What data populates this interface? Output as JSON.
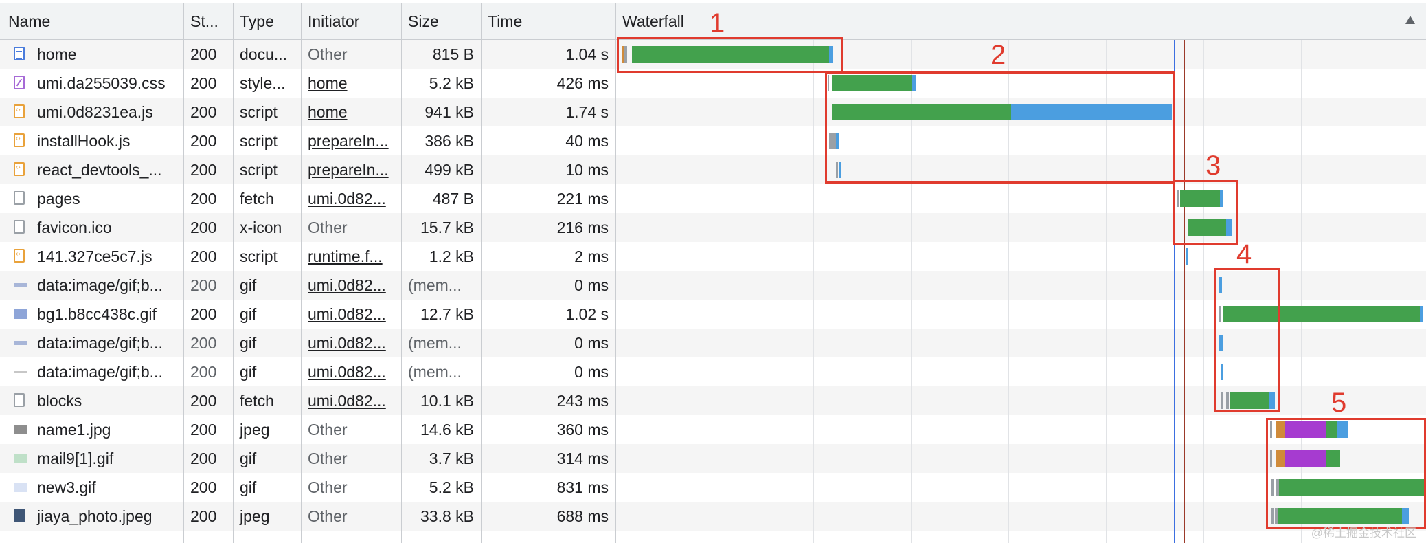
{
  "columns": {
    "name": "Name",
    "status": "St...",
    "type": "Type",
    "initiator": "Initiator",
    "size": "Size",
    "time": "Time",
    "waterfall": "Waterfall"
  },
  "rows": [
    {
      "name": "home",
      "status": "200",
      "type": "docu...",
      "initiator": "Other",
      "size": "815 B",
      "time": "1.04 s",
      "icon": "document-icon"
    },
    {
      "name": "umi.da255039.css",
      "status": "200",
      "type": "style...",
      "initiator": "home",
      "size": "5.2 kB",
      "time": "426 ms",
      "icon": "stylesheet-icon"
    },
    {
      "name": "umi.0d8231ea.js",
      "status": "200",
      "type": "script",
      "initiator": "home",
      "size": "941 kB",
      "time": "1.74 s",
      "icon": "script-icon"
    },
    {
      "name": "installHook.js",
      "status": "200",
      "type": "script",
      "initiator": "prepareIn...",
      "size": "386 kB",
      "time": "40 ms",
      "icon": "script-icon"
    },
    {
      "name": "react_devtools_...",
      "status": "200",
      "type": "script",
      "initiator": "prepareIn...",
      "size": "499 kB",
      "time": "10 ms",
      "icon": "script-icon"
    },
    {
      "name": "pages",
      "status": "200",
      "type": "fetch",
      "initiator": "umi.0d82...",
      "size": "487 B",
      "time": "221 ms",
      "icon": "fetch-icon"
    },
    {
      "name": "favicon.ico",
      "status": "200",
      "type": "x-icon",
      "initiator": "Other",
      "size": "15.7 kB",
      "time": "216 ms",
      "icon": "blank-file-icon"
    },
    {
      "name": "141.327ce5c7.js",
      "status": "200",
      "type": "script",
      "initiator": "runtime.f...",
      "size": "1.2 kB",
      "time": "2 ms",
      "icon": "script-icon"
    },
    {
      "name": "data:image/gif;b...",
      "status": "200",
      "type": "gif",
      "initiator": "umi.0d82...",
      "size": "(mem...",
      "time": "0 ms",
      "icon": "image-icon"
    },
    {
      "name": "bg1.b8cc438c.gif",
      "status": "200",
      "type": "gif",
      "initiator": "umi.0d82...",
      "size": "12.7 kB",
      "time": "1.02 s",
      "icon": "image-icon"
    },
    {
      "name": "data:image/gif;b...",
      "status": "200",
      "type": "gif",
      "initiator": "umi.0d82...",
      "size": "(mem...",
      "time": "0 ms",
      "icon": "image-icon"
    },
    {
      "name": "data:image/gif;b...",
      "status": "200",
      "type": "gif",
      "initiator": "umi.0d82...",
      "size": "(mem...",
      "time": "0 ms",
      "icon": "image-icon"
    },
    {
      "name": "blocks",
      "status": "200",
      "type": "fetch",
      "initiator": "umi.0d82...",
      "size": "10.1 kB",
      "time": "243 ms",
      "icon": "fetch-icon"
    },
    {
      "name": "name1.jpg",
      "status": "200",
      "type": "jpeg",
      "initiator": "Other",
      "size": "14.6 kB",
      "time": "360 ms",
      "icon": "image-icon"
    },
    {
      "name": "mail9[1].gif",
      "status": "200",
      "type": "gif",
      "initiator": "Other",
      "size": "3.7 kB",
      "time": "314 ms",
      "icon": "image-icon"
    },
    {
      "name": "new3.gif",
      "status": "200",
      "type": "gif",
      "initiator": "Other",
      "size": "5.2 kB",
      "time": "831 ms",
      "icon": "image-icon"
    },
    {
      "name": "jiaya_photo.jpeg",
      "status": "200",
      "type": "jpeg",
      "initiator": "Other",
      "size": "33.8 kB",
      "time": "688 ms",
      "icon": "image-icon"
    }
  ],
  "annotations": [
    "1",
    "2",
    "3",
    "4",
    "5"
  ],
  "watermark": "@稀土掘金技术社区",
  "colors": {
    "download": "#43a14d",
    "waiting": "#4b9ee0",
    "queueing": "#9aa0a6",
    "ssl": "#a63bd0",
    "connect": "#d08b3a",
    "annotation": "#e03b2e",
    "dom_content_loaded": "#3d6fe0",
    "load": "#9b3a2a"
  }
}
